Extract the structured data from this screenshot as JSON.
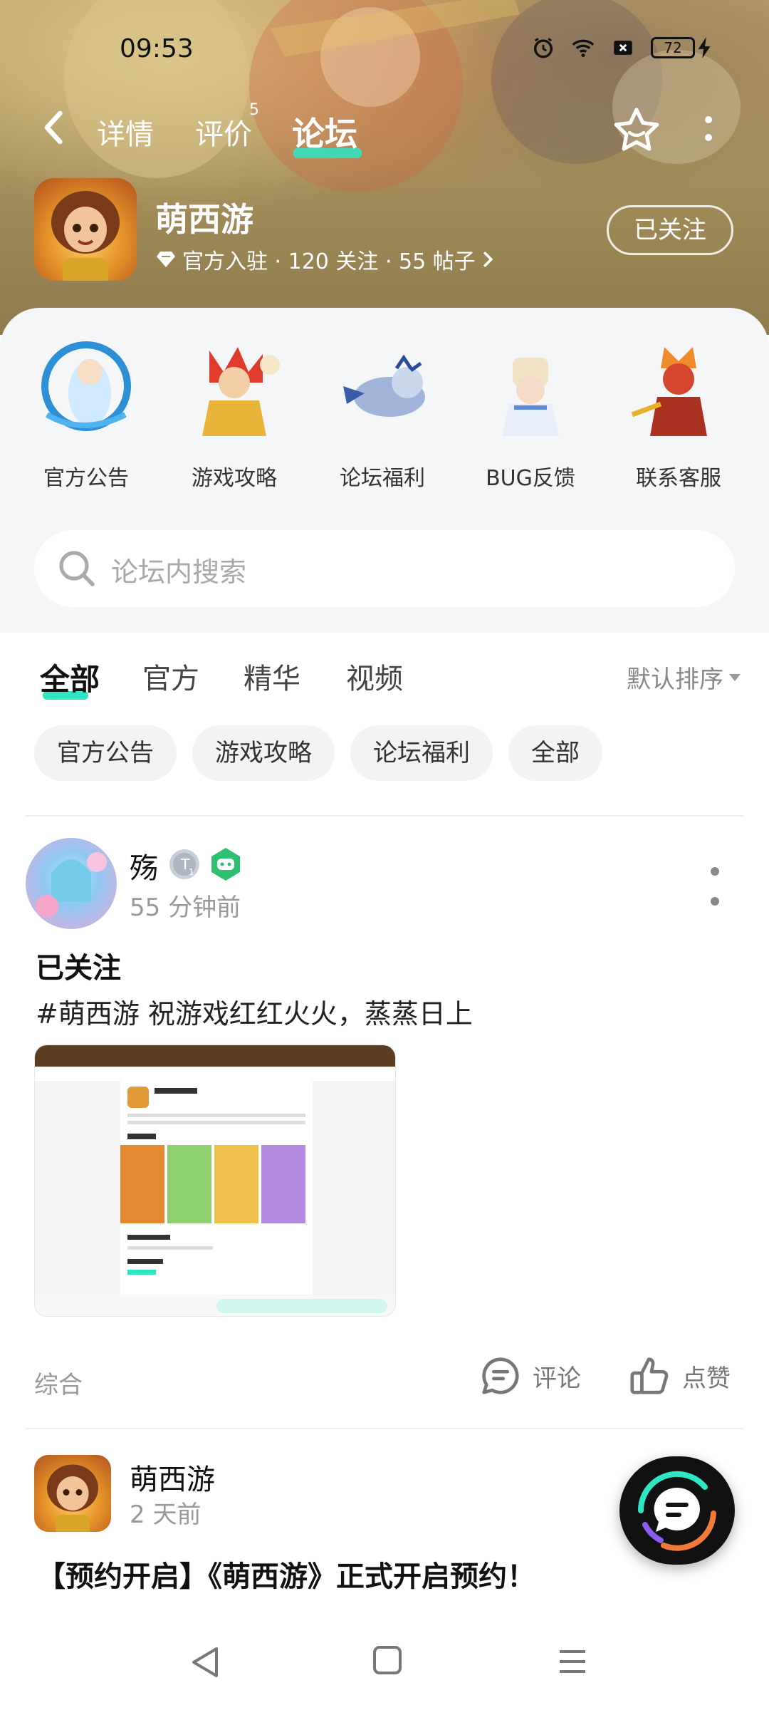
{
  "status_bar": {
    "time": "09:53",
    "battery": "72"
  },
  "nav": {
    "tabs": [
      {
        "label": "详情"
      },
      {
        "label": "评价",
        "count": "5"
      },
      {
        "label": "论坛",
        "active": true
      }
    ]
  },
  "game": {
    "name": "萌西游",
    "meta": "官方入驻 · 120 关注 · 55 帖子",
    "follow_label": "已关注"
  },
  "categories": [
    {
      "label": "官方公告"
    },
    {
      "label": "游戏攻略"
    },
    {
      "label": "论坛福利"
    },
    {
      "label": "BUG反馈"
    },
    {
      "label": "联系客服"
    }
  ],
  "search": {
    "placeholder": "论坛内搜索"
  },
  "filter_tabs": [
    {
      "label": "全部",
      "active": true
    },
    {
      "label": "官方"
    },
    {
      "label": "精华"
    },
    {
      "label": "视频"
    }
  ],
  "sort_label": "默认排序",
  "chips": [
    "官方公告",
    "游戏攻略",
    "论坛福利",
    "全部"
  ],
  "posts": [
    {
      "author": "殇",
      "level": "1",
      "time": "55 分钟前",
      "title": "已关注",
      "body": "#萌西游 祝游戏红红火火，蒸蒸日上",
      "category": "综合",
      "comment_label": "评论",
      "like_label": "点赞"
    },
    {
      "author": "萌西游",
      "time": "2 天前",
      "title": "【预约开启】《萌西游》正式开启预约！"
    }
  ],
  "colors": {
    "accent": "#2ee6c4",
    "vip_green": "#2fbf71"
  },
  "icons": [
    "back-arrow-icon",
    "star-icon",
    "more-vertical-icon",
    "diamond-icon",
    "search-icon",
    "comment-icon",
    "like-icon",
    "chat-icon"
  ]
}
